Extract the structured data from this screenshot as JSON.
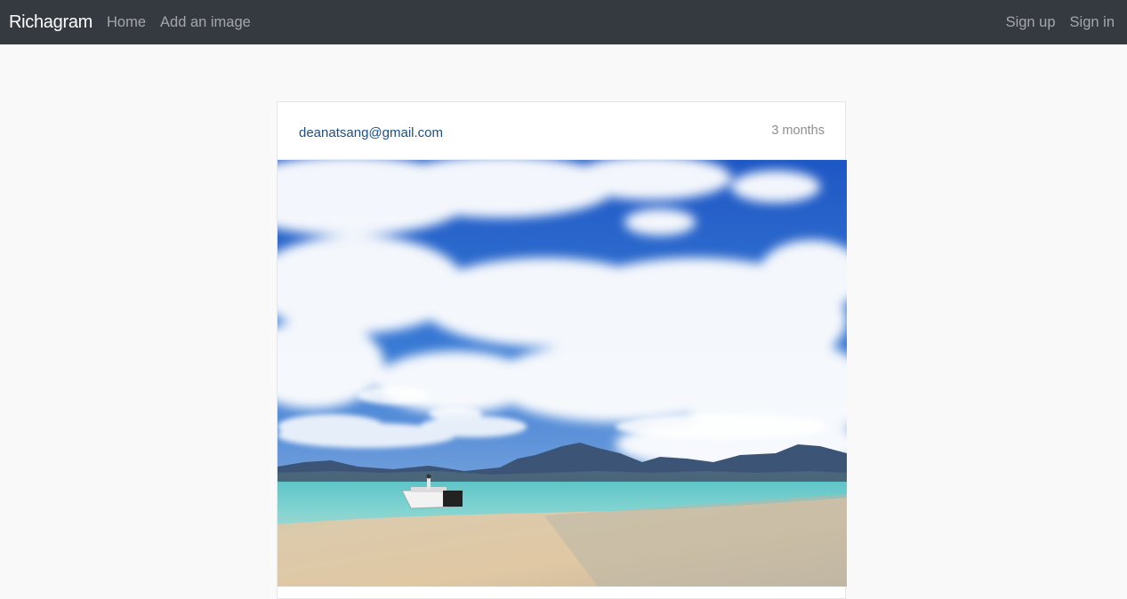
{
  "navbar": {
    "brand": "Richagram",
    "links_left": [
      "Home",
      "Add an image"
    ],
    "links_right": [
      "Sign up",
      "Sign in"
    ]
  },
  "post": {
    "author": "deanatsang@gmail.com",
    "timestamp": "3 months",
    "image_icon": "photo-beach-boat"
  },
  "colors": {
    "navbar_bg": "#343a40",
    "page_bg": "#f9f9f9",
    "author_link": "#1d4f85",
    "muted_text": "#8e8e8e"
  }
}
